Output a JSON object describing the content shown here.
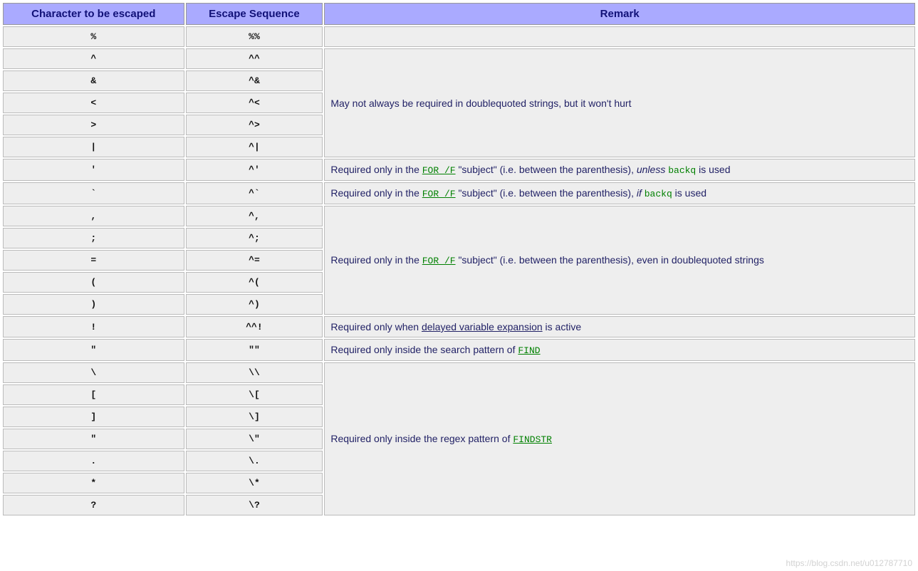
{
  "headers": {
    "char": "Character to be escaped",
    "seq": "Escape Sequence",
    "remark": "Remark"
  },
  "rows": [
    {
      "char": "%",
      "seq": "%%"
    },
    {
      "char": "^",
      "seq": "^^"
    },
    {
      "char": "&",
      "seq": "^&"
    },
    {
      "char": "<",
      "seq": "^<"
    },
    {
      "char": ">",
      "seq": "^>"
    },
    {
      "char": "|",
      "seq": "^|"
    },
    {
      "char": "'",
      "seq": "^'"
    },
    {
      "char": "`",
      "seq": "^`"
    },
    {
      "char": ",",
      "seq": "^,"
    },
    {
      "char": ";",
      "seq": "^;"
    },
    {
      "char": "=",
      "seq": "^="
    },
    {
      "char": "(",
      "seq": "^("
    },
    {
      "char": ")",
      "seq": "^)"
    },
    {
      "char": "!",
      "seq": "^^!"
    },
    {
      "char": "\"",
      "seq": "\"\""
    },
    {
      "char": "\\",
      "seq": "\\\\"
    },
    {
      "char": "[",
      "seq": "\\["
    },
    {
      "char": "]",
      "seq": "\\]"
    },
    {
      "char": "\"",
      "seq": "\\\""
    },
    {
      "char": ".",
      "seq": "\\."
    },
    {
      "char": "*",
      "seq": "\\*"
    },
    {
      "char": "?",
      "seq": "\\?"
    }
  ],
  "remarks": {
    "r1": {
      "text": "May not always be required in doublequoted strings, but it won't hurt"
    },
    "r2": {
      "pre": "Required only in the ",
      "link": "FOR /F",
      "mid": " \"subject\" (i.e. between the parenthesis), ",
      "em": "unless",
      "post1": " ",
      "code": "backq",
      "post2": " is used"
    },
    "r3": {
      "pre": "Required only in the ",
      "link": "FOR /F",
      "mid": " \"subject\" (i.e. between the parenthesis), ",
      "em": "if",
      "post1": " ",
      "code": "backq",
      "post2": " is used"
    },
    "r4": {
      "pre": "Required only in the ",
      "link": "FOR /F",
      "post": " \"subject\" (i.e. between the parenthesis), even in doublequoted strings"
    },
    "r5": {
      "pre": "Required only when ",
      "link": "delayed variable expansion",
      "post": " is active"
    },
    "r6": {
      "pre": "Required only inside the search pattern of ",
      "link": "FIND"
    },
    "r7": {
      "pre": "Required only inside the regex pattern of ",
      "link": "FINDSTR"
    }
  },
  "watermark": "https://blog.csdn.net/u012787710"
}
